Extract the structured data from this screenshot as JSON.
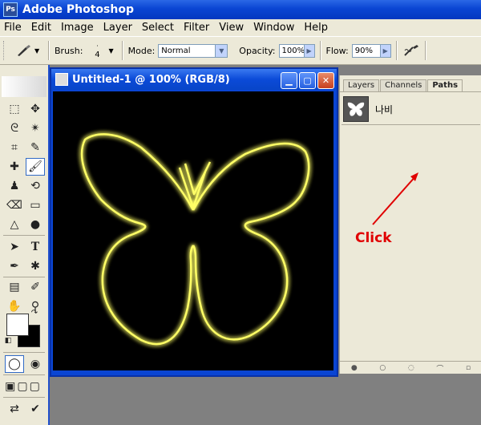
{
  "window": {
    "title": "Adobe Photoshop"
  },
  "menu": [
    "File",
    "Edit",
    "Image",
    "Layer",
    "Select",
    "Filter",
    "View",
    "Window",
    "Help"
  ],
  "options": {
    "brush_label": "Brush:",
    "brush_size": "4",
    "mode_label": "Mode:",
    "mode_value": "Normal",
    "opacity_label": "Opacity:",
    "opacity_value": "100%",
    "flow_label": "Flow:",
    "flow_value": "90%"
  },
  "document": {
    "title": "Untitled-1 @ 100% (RGB/8)"
  },
  "panel": {
    "tabs": [
      "Layers",
      "Channels",
      "Paths"
    ],
    "active_tab": "Paths",
    "path_name": "나비"
  },
  "annotation": {
    "text": "Click",
    "color": "#e00000"
  },
  "colors": {
    "title_bar": "#0a45d3",
    "glow": "#ffff66",
    "canvas": "#000000"
  }
}
